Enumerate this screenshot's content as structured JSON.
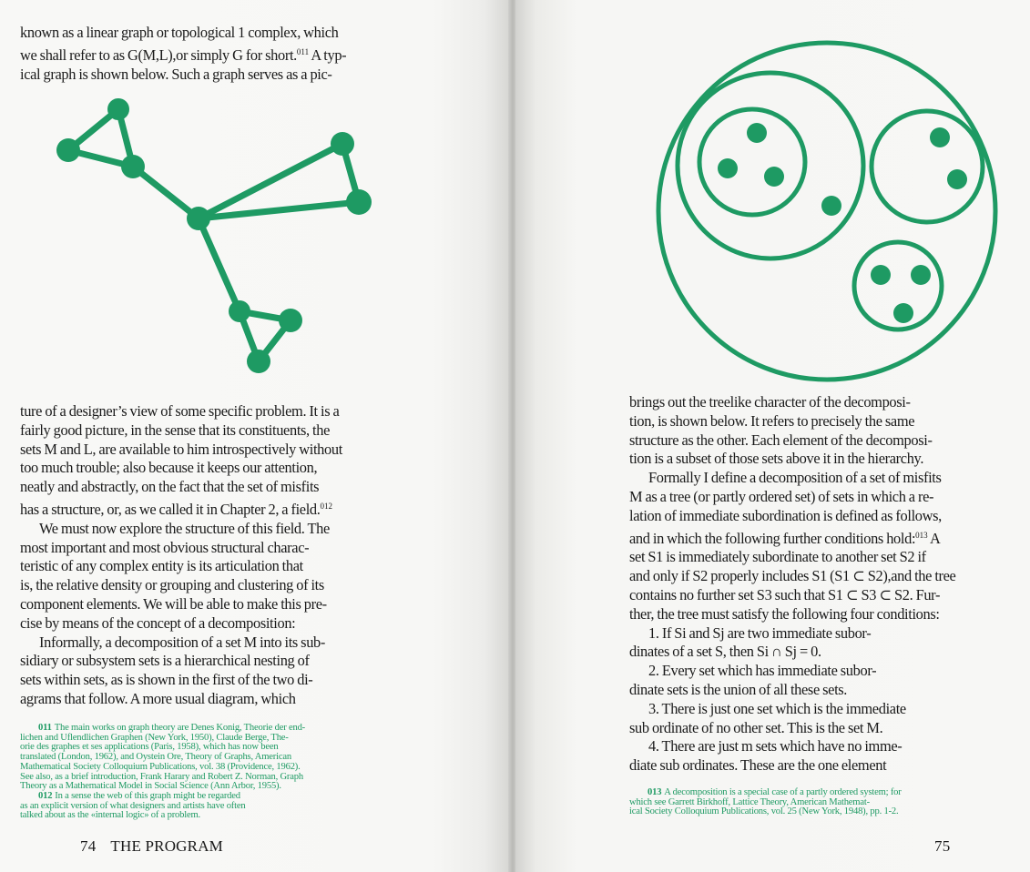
{
  "left_page": {
    "top_lines": [
      "known as a linear graph or topological 1  complex, which",
      "we shall refer to as G(M,L),or simply G for short.",
      "ical graph is shown below. Such a graph serves as a pic-"
    ],
    "top_sup": "011",
    "top_line2_tail": " A typ-",
    "para1": [
      "ture of a designer’s view of some specific problem. It is a",
      "fairly good picture, in the sense that its constituents, the",
      "sets M and L, are available to him introspectively without",
      "too much trouble; also because it keeps our attention,",
      "neatly and abstractly, on the fact that the set of misfits",
      "has a structure, or, as we called it in Chapter 2, a field."
    ],
    "para1_sup": "012",
    "para2": [
      "We must now explore the structure of this field. The",
      "most important and most obvious structural charac-",
      "teristic of any complex entity is its articulation    that",
      "is, the relative density or grouping and clustering of its",
      "component elements. We will be able to make this pre-",
      "cise by means of the concept of a decomposition:"
    ],
    "para3": [
      "Informally, a decomposition of a set M into its sub-",
      "sidiary or subsystem sets is a hierarchical nesting of",
      "sets within sets, as is shown in the first of the two di-",
      "agrams that follow. A more usual diagram, which"
    ],
    "footnote_011_num": "011",
    "footnote_011": [
      "The main works on graph theory are Denes Konig, Theorie der end-",
      "lichen and Uflendlichen Graphen (New York, 1950), Claude Berge, The-",
      "orie des graphes et ses applications (Paris, 1958), which has now been",
      "translated (London, 1962), and Oystein Ore, Theory of Graphs, American",
      "Mathematical Society Colloquium Publications, vol. 38 (Providence, 1962).",
      "See also, as a brief introduction, Frank Harary and Robert Z. Norman, Graph",
      "Theory as a Mathematical Model in Social Science (Ann Arbor, 1955)."
    ],
    "footnote_012_num": "012",
    "footnote_012": [
      "In a sense the web of this graph might be regarded",
      "as an explicit version of what designers and artists have often",
      "talked about as the «internal logic» of a problem."
    ],
    "folio_number": "74",
    "folio_title": "THE PROGRAM"
  },
  "right_page": {
    "para1": [
      "brings out the treelike character of the decomposi-",
      "tion, is shown below. It refers to precisely the same",
      "structure as the other. Each element of the decomposi-",
      "tion is a subset of those sets above it in the hierarchy."
    ],
    "para2": [
      "Formally I define a decomposition of a set of misfits",
      "M as a tree (or partly ordered set) of sets in which a re-",
      "lation of immediate subordination is defined as follows,",
      "and in which the following further conditions hold:",
      "set S1 is immediately subordinate to another set S2 if",
      "and only if S2 properly includes S1 (S1 ⊂ S2),and the tree",
      "contains no further set S3 such that S1 ⊂  S3 ⊂ S2. Fur-",
      "ther, the tree must satisfy the following four conditions:"
    ],
    "para2_sup": "013",
    "para2_line4_tail": " A",
    "conditions": [
      [
        "1. If Si and Sj are two immediate subor-",
        "dinates of a set S, then Si ∩ Sj = 0."
      ],
      [
        "2. Every set which has immediate subor-",
        "dinate sets is the union of all these sets."
      ],
      [
        "3. There is just one set which is the immediate",
        "sub ordinate of no other set. This is the set M."
      ],
      [
        "4. There are just m sets which have no imme-",
        "diate sub ordinates. These are the one  element"
      ]
    ],
    "footnote_013_num": "013",
    "footnote_013": [
      "A decomposition is a special case of a partly ordered system; for",
      "which see Garrett Birkhoff, Lattice Theory, American Mathemat-",
      "ical Society Colloquium Publications, vol. 25 (New York, 1948), pp. 1-2."
    ],
    "folio_number": "75"
  },
  "colors": {
    "accent_green": "#1e9a63",
    "text": "#1a1a1a",
    "paper": "#f7f7f5"
  }
}
